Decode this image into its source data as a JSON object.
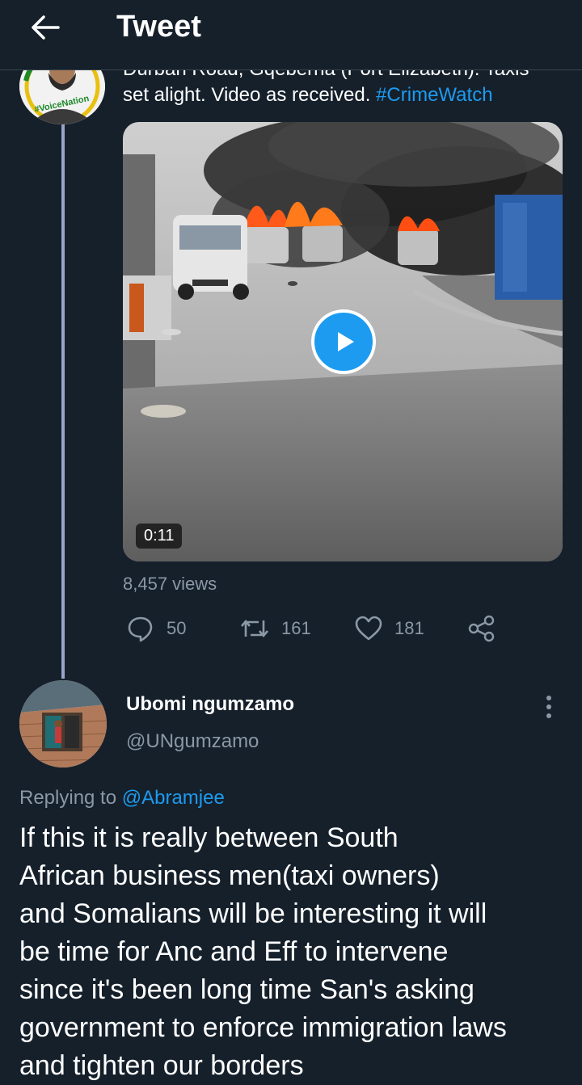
{
  "header": {
    "title": "Tweet",
    "back_icon": "arrow-left-icon"
  },
  "tweet": {
    "text_line1": "Durban Road, Gqeberha (Port Elizabeth): Taxis",
    "text_line2": "set alight. Video as received. ",
    "hashtag": "#CrimeWatch",
    "avatar_text": "#VoiceNation",
    "video_duration": "0:11",
    "views": "8,457 views",
    "actions": {
      "reply_count": "50",
      "retweet_count": "161",
      "like_count": "181"
    }
  },
  "reply": {
    "display_name": "Ubomi ngumzamo",
    "handle": "@UNgumzamo",
    "replying_prefix": "Replying to ",
    "replying_mention": "@Abramjee",
    "lines": [
      "If this it is really between South",
      "African business men(taxi owners)",
      "and Somalians will be interesting it will",
      "be time for Anc and Eff to intervene",
      "since it's been long time San's asking",
      "government to enforce immigration laws",
      "and tighten our borders"
    ]
  },
  "colors": {
    "background": "#15202b",
    "accent": "#1d9bf0",
    "muted": "#8b98a5",
    "thread_line": "#9aa3c9"
  }
}
